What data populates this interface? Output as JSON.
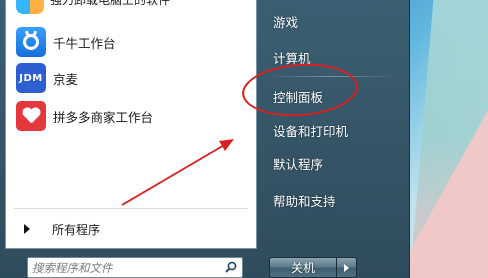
{
  "left_pane": {
    "top_cut_label": "强力卸载电脑上的软件",
    "apps": [
      {
        "label": "千牛工作台",
        "icon": "qianniu-icon"
      },
      {
        "label": "京麦",
        "icon": "jd-icon",
        "icon_text": "JDM"
      },
      {
        "label": "拼多多商家工作台",
        "icon": "pinduoduo-icon"
      }
    ],
    "all_programs": "所有程序"
  },
  "search": {
    "placeholder": "搜索程序和文件"
  },
  "right_pane": {
    "items": [
      {
        "label": "游戏"
      },
      {
        "label": "计算机"
      },
      {
        "label": "控制面板"
      },
      {
        "label": "设备和打印机"
      },
      {
        "label": "默认程序"
      },
      {
        "label": "帮助和支持"
      }
    ]
  },
  "shutdown": {
    "label": "关机"
  },
  "colors": {
    "annotation": "#d9201f",
    "menu_frame": "#3b5f72"
  }
}
